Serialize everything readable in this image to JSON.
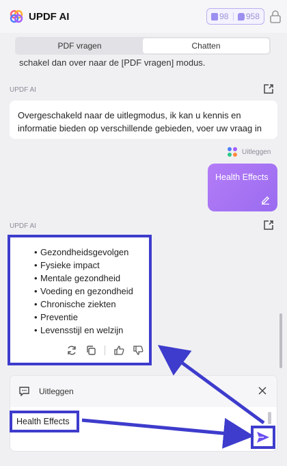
{
  "header": {
    "title": "UPDF AI",
    "quota_pdf": "98",
    "quota_chat": "958",
    "logo_icon": "updf-logo-icon",
    "lock_icon": "lock-icon"
  },
  "tabs": [
    {
      "label": "PDF vragen",
      "active": false
    },
    {
      "label": "Chatten",
      "active": true
    }
  ],
  "chat": {
    "clipped_text": "schakel dan over naar de [PDF vragen] modus.",
    "sender_1": "UPDF AI",
    "ai_message": "Overgeschakeld naar de uitlegmodus, ik kan u kennis en informatie bieden op verschillende gebieden, voer uw vraag in",
    "mode_tag": "Uitleggen",
    "user_message": "Health Effects",
    "sender_2": "UPDF AI",
    "result_items": [
      "Gezondheidsgevolgen",
      "Fysieke impact",
      "Mentale gezondheid",
      "Voeding en gezondheid",
      "Chronische ziekten",
      "Preventie",
      "Levensstijl en welzijn"
    ]
  },
  "input": {
    "mode_label": "Uitleggen",
    "value": "Health Effects"
  },
  "colors": {
    "accent": "#3e3ccc",
    "user_bubble": "#a673f3",
    "quota_border": "#b7b0f0"
  }
}
